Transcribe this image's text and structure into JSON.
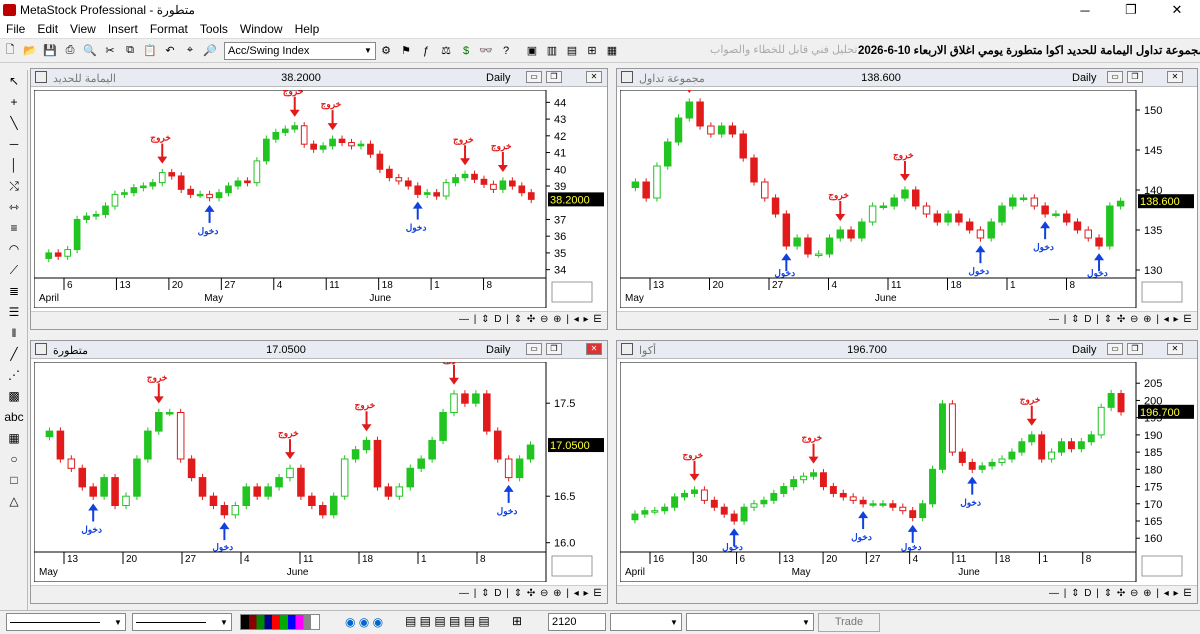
{
  "app": {
    "title": "MetaStock Professional - متطورة"
  },
  "menu": [
    "File",
    "Edit",
    "View",
    "Insert",
    "Format",
    "Tools",
    "Window",
    "Help"
  ],
  "toolbar": {
    "indicator": "Acc/Swing Index",
    "faint_note": "تحليل فني قابل للخطاء والصواب",
    "headline": "مجموعة تداول اليمامة للحديد اكوا متطورة يومي اغلاق الاربعاء 10-6-2026"
  },
  "charts": [
    {
      "name": "اليمامة للحديد",
      "value": "38.2000",
      "period": "Daily",
      "last": "38.2000",
      "active": false
    },
    {
      "name": "مجموعة تداول",
      "value": "138.600",
      "period": "Daily",
      "last": "138.600",
      "active": false
    },
    {
      "name": "متطورة",
      "value": "17.0500",
      "period": "Daily",
      "last": "17.0500",
      "active": true
    },
    {
      "name": "أكوا",
      "value": "196.700",
      "period": "Daily",
      "last": "196.700",
      "active": false
    }
  ],
  "labels": {
    "exit": "خروج",
    "entry": "دخول"
  },
  "colors": {
    "up": "#21c421",
    "down": "#e11b1b",
    "arrow_exit": "#e11b1b",
    "arrow_entry": "#1040e0"
  },
  "bottombar": {
    "value": "2120",
    "trade": "Trade"
  },
  "chart_data": [
    {
      "type": "candlestick",
      "title": "اليمامة للحديد",
      "ylim": [
        33.5,
        44.5
      ],
      "y_ticks": [
        "44",
        "43",
        "42",
        "41",
        "40",
        "39",
        "37",
        "36",
        "35",
        "34"
      ],
      "x_ticks": [
        "6",
        "13",
        "20",
        "27",
        "4",
        "11",
        "18",
        "1",
        "8"
      ],
      "months": [
        "April",
        "May",
        "June"
      ],
      "closes": [
        35,
        34.8,
        35.2,
        37,
        37.2,
        37.3,
        37.8,
        38.5,
        38.6,
        38.9,
        39,
        39.2,
        39.8,
        39.6,
        38.8,
        38.5,
        38.5,
        38.3,
        38.6,
        39,
        39.3,
        39.2,
        40.5,
        41.8,
        42.2,
        42.4,
        42.6,
        41.5,
        41.2,
        41.4,
        41.8,
        41.6,
        41.4,
        41.5,
        40.9,
        40,
        39.5,
        39.3,
        39,
        38.5,
        38.6,
        38.4,
        39.2,
        39.5,
        39.7,
        39.4,
        39.1,
        38.8,
        39.3,
        39,
        38.6,
        38.2
      ]
    },
    {
      "type": "candlestick",
      "title": "مجموعة تداول",
      "ylim": [
        129,
        152
      ],
      "y_ticks": [
        "150",
        "145",
        "140",
        "135",
        "130"
      ],
      "x_ticks": [
        "13",
        "20",
        "27",
        "4",
        "11",
        "18",
        "1",
        "8"
      ],
      "months": [
        "May",
        "June"
      ],
      "closes": [
        141,
        139,
        143,
        146,
        149,
        151,
        148,
        147,
        148,
        147,
        144,
        141,
        139,
        137,
        133,
        134,
        132,
        132,
        134,
        135,
        134,
        136,
        138,
        138,
        139,
        140,
        138,
        137,
        136,
        137,
        136,
        135,
        134,
        136,
        138,
        139,
        139,
        138,
        137,
        137,
        136,
        135,
        134,
        133,
        138,
        138.6
      ]
    },
    {
      "type": "candlestick",
      "title": "متطورة",
      "ylim": [
        15.9,
        17.9
      ],
      "y_ticks": [
        "17.5",
        "16.5",
        "16.0"
      ],
      "x_ticks": [
        "13",
        "20",
        "27",
        "4",
        "11",
        "18",
        "1",
        "8"
      ],
      "months": [
        "May",
        "June"
      ],
      "closes": [
        17.2,
        16.9,
        16.8,
        16.6,
        16.5,
        16.7,
        16.4,
        16.5,
        16.9,
        17.2,
        17.4,
        17.4,
        16.9,
        16.7,
        16.5,
        16.4,
        16.3,
        16.4,
        16.6,
        16.5,
        16.6,
        16.7,
        16.8,
        16.5,
        16.4,
        16.3,
        16.5,
        16.9,
        17.0,
        17.1,
        16.6,
        16.5,
        16.6,
        16.8,
        16.9,
        17.1,
        17.4,
        17.6,
        17.5,
        17.6,
        17.2,
        16.9,
        16.7,
        16.9,
        17.05
      ]
    },
    {
      "type": "candlestick",
      "title": "أكوا",
      "ylim": [
        156,
        210
      ],
      "y_ticks": [
        "205",
        "200",
        "195",
        "190",
        "185",
        "180",
        "175",
        "170",
        "165",
        "160"
      ],
      "x_ticks": [
        "16",
        "30",
        "6",
        "13",
        "20",
        "27",
        "4",
        "11",
        "18",
        "1",
        "8"
      ],
      "months": [
        "April",
        "May",
        "June"
      ],
      "closes": [
        167,
        168,
        168,
        169,
        172,
        173,
        174,
        171,
        169,
        167,
        165,
        169,
        170,
        171,
        173,
        175,
        177,
        178,
        179,
        175,
        173,
        172,
        171,
        170,
        170,
        170,
        169,
        168,
        166,
        170,
        180,
        199,
        185,
        182,
        180,
        181,
        182,
        183,
        185,
        188,
        190,
        183,
        185,
        188,
        186,
        188,
        190,
        198,
        202,
        196.7
      ]
    }
  ]
}
